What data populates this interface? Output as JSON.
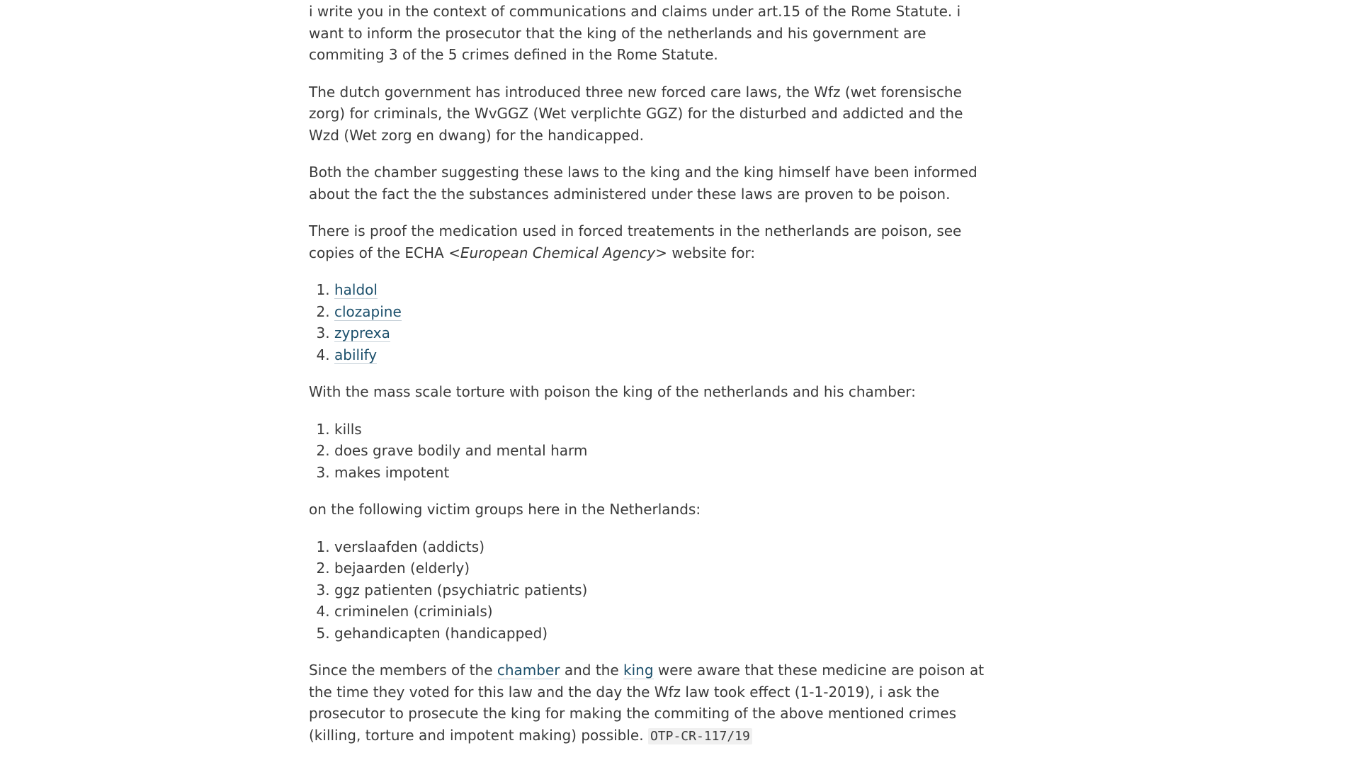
{
  "article": {
    "p1": "i write you in the context of communications and claims under art.15 of the Rome Statute. i want to inform the prosecutor that the king of the netherlands and his government are commiting 3 of the 5 crimes defined in the Rome Statute.",
    "p2": "The dutch government has introduced three new forced care laws, the Wfz (wet forensische zorg) for criminals, the WvGGZ (Wet verplichte GGZ) for the disturbed and addicted and the Wzd (Wet zorg en dwang) for the handicapped.",
    "p3": "Both the chamber suggesting these laws to the king and the king himself have been informed about the fact the the substances administered under these laws are proven to be poison.",
    "p4_before": "There is proof the medication used in forced treatements in the netherlands are poison, see copies of the ECHA ",
    "p4_em": "<European Chemical Agency>",
    "p4_after": " website for:",
    "medications": [
      "haldol",
      "clozapine",
      "zyprexa",
      "abilify"
    ],
    "p5": "With the mass scale torture with poison the king of the netherlands and his chamber:",
    "harms": [
      "kills",
      "does grave bodily and mental harm",
      "makes impotent"
    ],
    "p6": "on the following victim groups here in the Netherlands:",
    "victims": [
      "verslaafden (addicts)",
      "bejaarden (elderly)",
      "ggz patienten (psychiatric patients)",
      "criminelen (criminials)",
      "gehandicapten (handicapped)"
    ],
    "p7_part1": "Since the members of the ",
    "p7_link1": "chamber",
    "p7_part2": " and the ",
    "p7_link2": "king",
    "p7_part3": " were aware that these medicine are poison at the time they voted for this law and the day the Wfz law took effect (1-1-2019), i ask the prosecutor to prosecute the king for making the commiting of the above mentioned crimes (killing, torture and impotent making) possible. ",
    "p7_code": "OTP-CR-117/19"
  },
  "colors": {
    "text": "#3a3a3a",
    "link": "#1b4f6b",
    "code_bg": "#f0f0f0"
  }
}
